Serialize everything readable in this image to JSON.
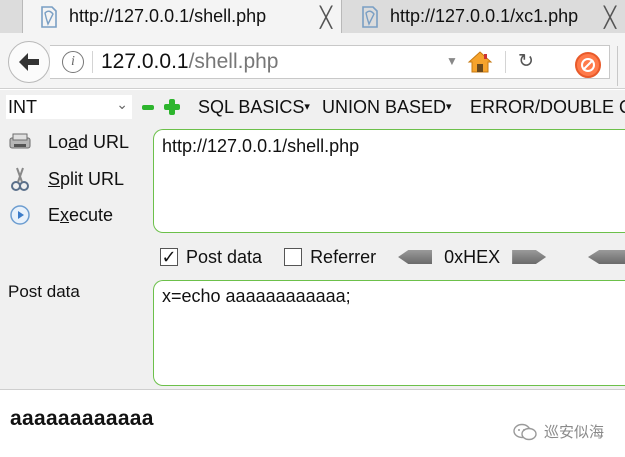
{
  "tabs": [
    {
      "title": "http://127.0.0.1/shell.php",
      "active": true,
      "close": "╳"
    },
    {
      "title": "http://127.0.0.1/xc1.php",
      "active": false,
      "close": "╳"
    }
  ],
  "navbar": {
    "url_host": "127.0.0.1",
    "url_path": "/shell.php",
    "info_icon": "i",
    "dropdown": "▼",
    "reload": "↻"
  },
  "hackbar": {
    "select_value": "INT",
    "select_chevron": "⌄",
    "menus": [
      {
        "label": "SQL BASICS",
        "dd": "▾"
      },
      {
        "label": "UNION BASED",
        "dd": "▾"
      },
      {
        "label": "ERROR/DOUBLE Q",
        "dd": ""
      }
    ],
    "buttons": {
      "load_pre": "Lo",
      "load_u": "a",
      "load_post": "d URL",
      "split_pre": "",
      "split_u": "S",
      "split_post": "plit URL",
      "exec_pre": "E",
      "exec_u": "x",
      "exec_post": "ecute"
    },
    "url_value": "http://127.0.0.1/shell.php",
    "post_checkbox_label": "Post data",
    "post_checked_mark": "✓",
    "referrer_label": "Referrer",
    "hex_label": "0xHEX",
    "post_data_label": "Post data",
    "post_value": "x=echo aaaaaaaaaaaa;"
  },
  "page": {
    "output_text": "aaaaaaaaaaaa"
  },
  "watermark": {
    "text": "巡安似海"
  },
  "colors": {
    "hackbar_green": "#2db52d",
    "field_border": "#6cc04a",
    "tab_active": "#f4f4f4",
    "tab_inactive": "#dcdcdc"
  }
}
